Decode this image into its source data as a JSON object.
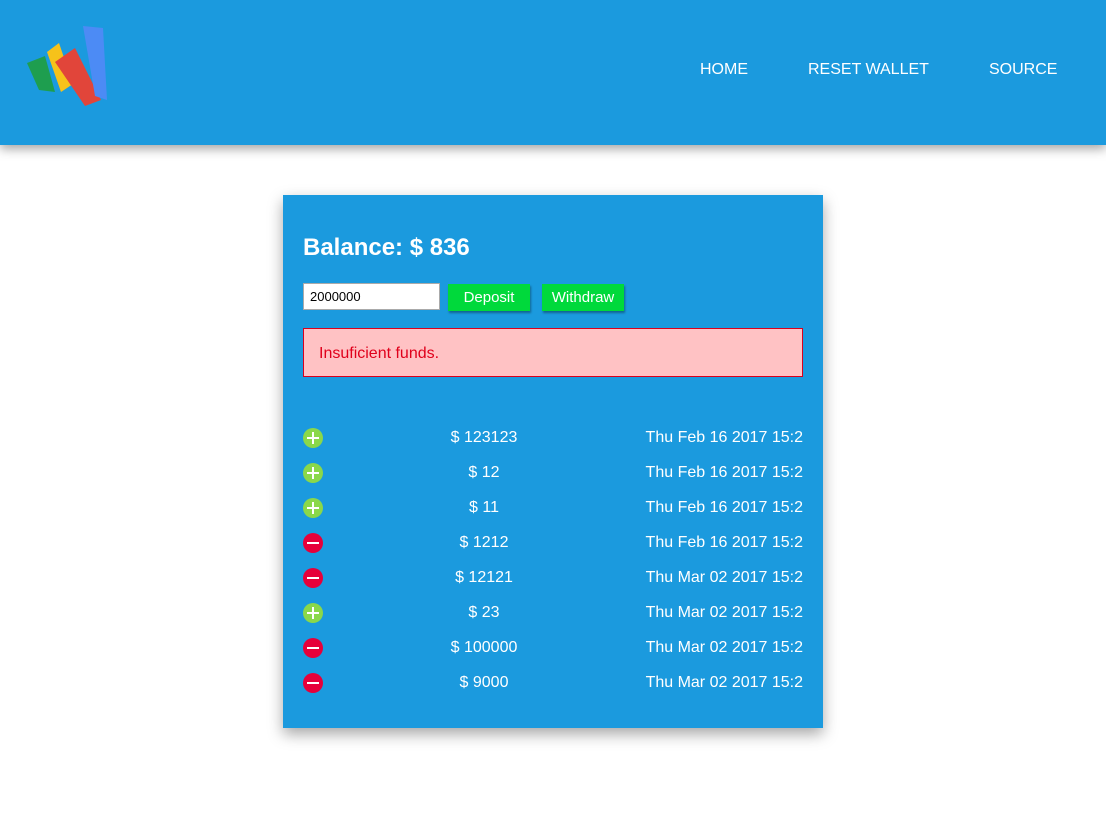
{
  "nav": {
    "logo": "wallet-logo-icon",
    "items": [
      "HOME",
      "RESET WALLET",
      "SOURCE"
    ]
  },
  "wallet": {
    "balance_label": "Balance:",
    "balance_value": "$ 836",
    "amount_value": "2000000",
    "deposit_label": "Deposit",
    "withdraw_label": "Withdraw",
    "error_message": "Insuficient funds."
  },
  "transactions": [
    {
      "type": "credit",
      "icon": "plus-circle-icon",
      "amount": "$ 123123",
      "date": "Thu Feb 16 2017 15:2"
    },
    {
      "type": "credit",
      "icon": "plus-circle-icon",
      "amount": "$ 12",
      "date": "Thu Feb 16 2017 15:2"
    },
    {
      "type": "credit",
      "icon": "plus-circle-icon",
      "amount": "$ 11",
      "date": "Thu Feb 16 2017 15:2"
    },
    {
      "type": "debit",
      "icon": "minus-circle-icon",
      "amount": "$ 1212",
      "date": "Thu Feb 16 2017 15:2"
    },
    {
      "type": "debit",
      "icon": "minus-circle-icon",
      "amount": "$ 12121",
      "date": "Thu Mar 02 2017 15:2"
    },
    {
      "type": "credit",
      "icon": "plus-circle-icon",
      "amount": "$ 23",
      "date": "Thu Mar 02 2017 15:2"
    },
    {
      "type": "debit",
      "icon": "minus-circle-icon",
      "amount": "$ 100000",
      "date": "Thu Mar 02 2017 15:2"
    },
    {
      "type": "debit",
      "icon": "minus-circle-icon",
      "amount": "$ 9000",
      "date": "Thu Mar 02 2017 15:2"
    }
  ],
  "colors": {
    "primary": "#1b9ade",
    "button": "#00d93b",
    "credit": "#8ad84a",
    "debit": "#e6003a",
    "error_bg": "#ffc2c4",
    "error_text": "#e0001b"
  }
}
